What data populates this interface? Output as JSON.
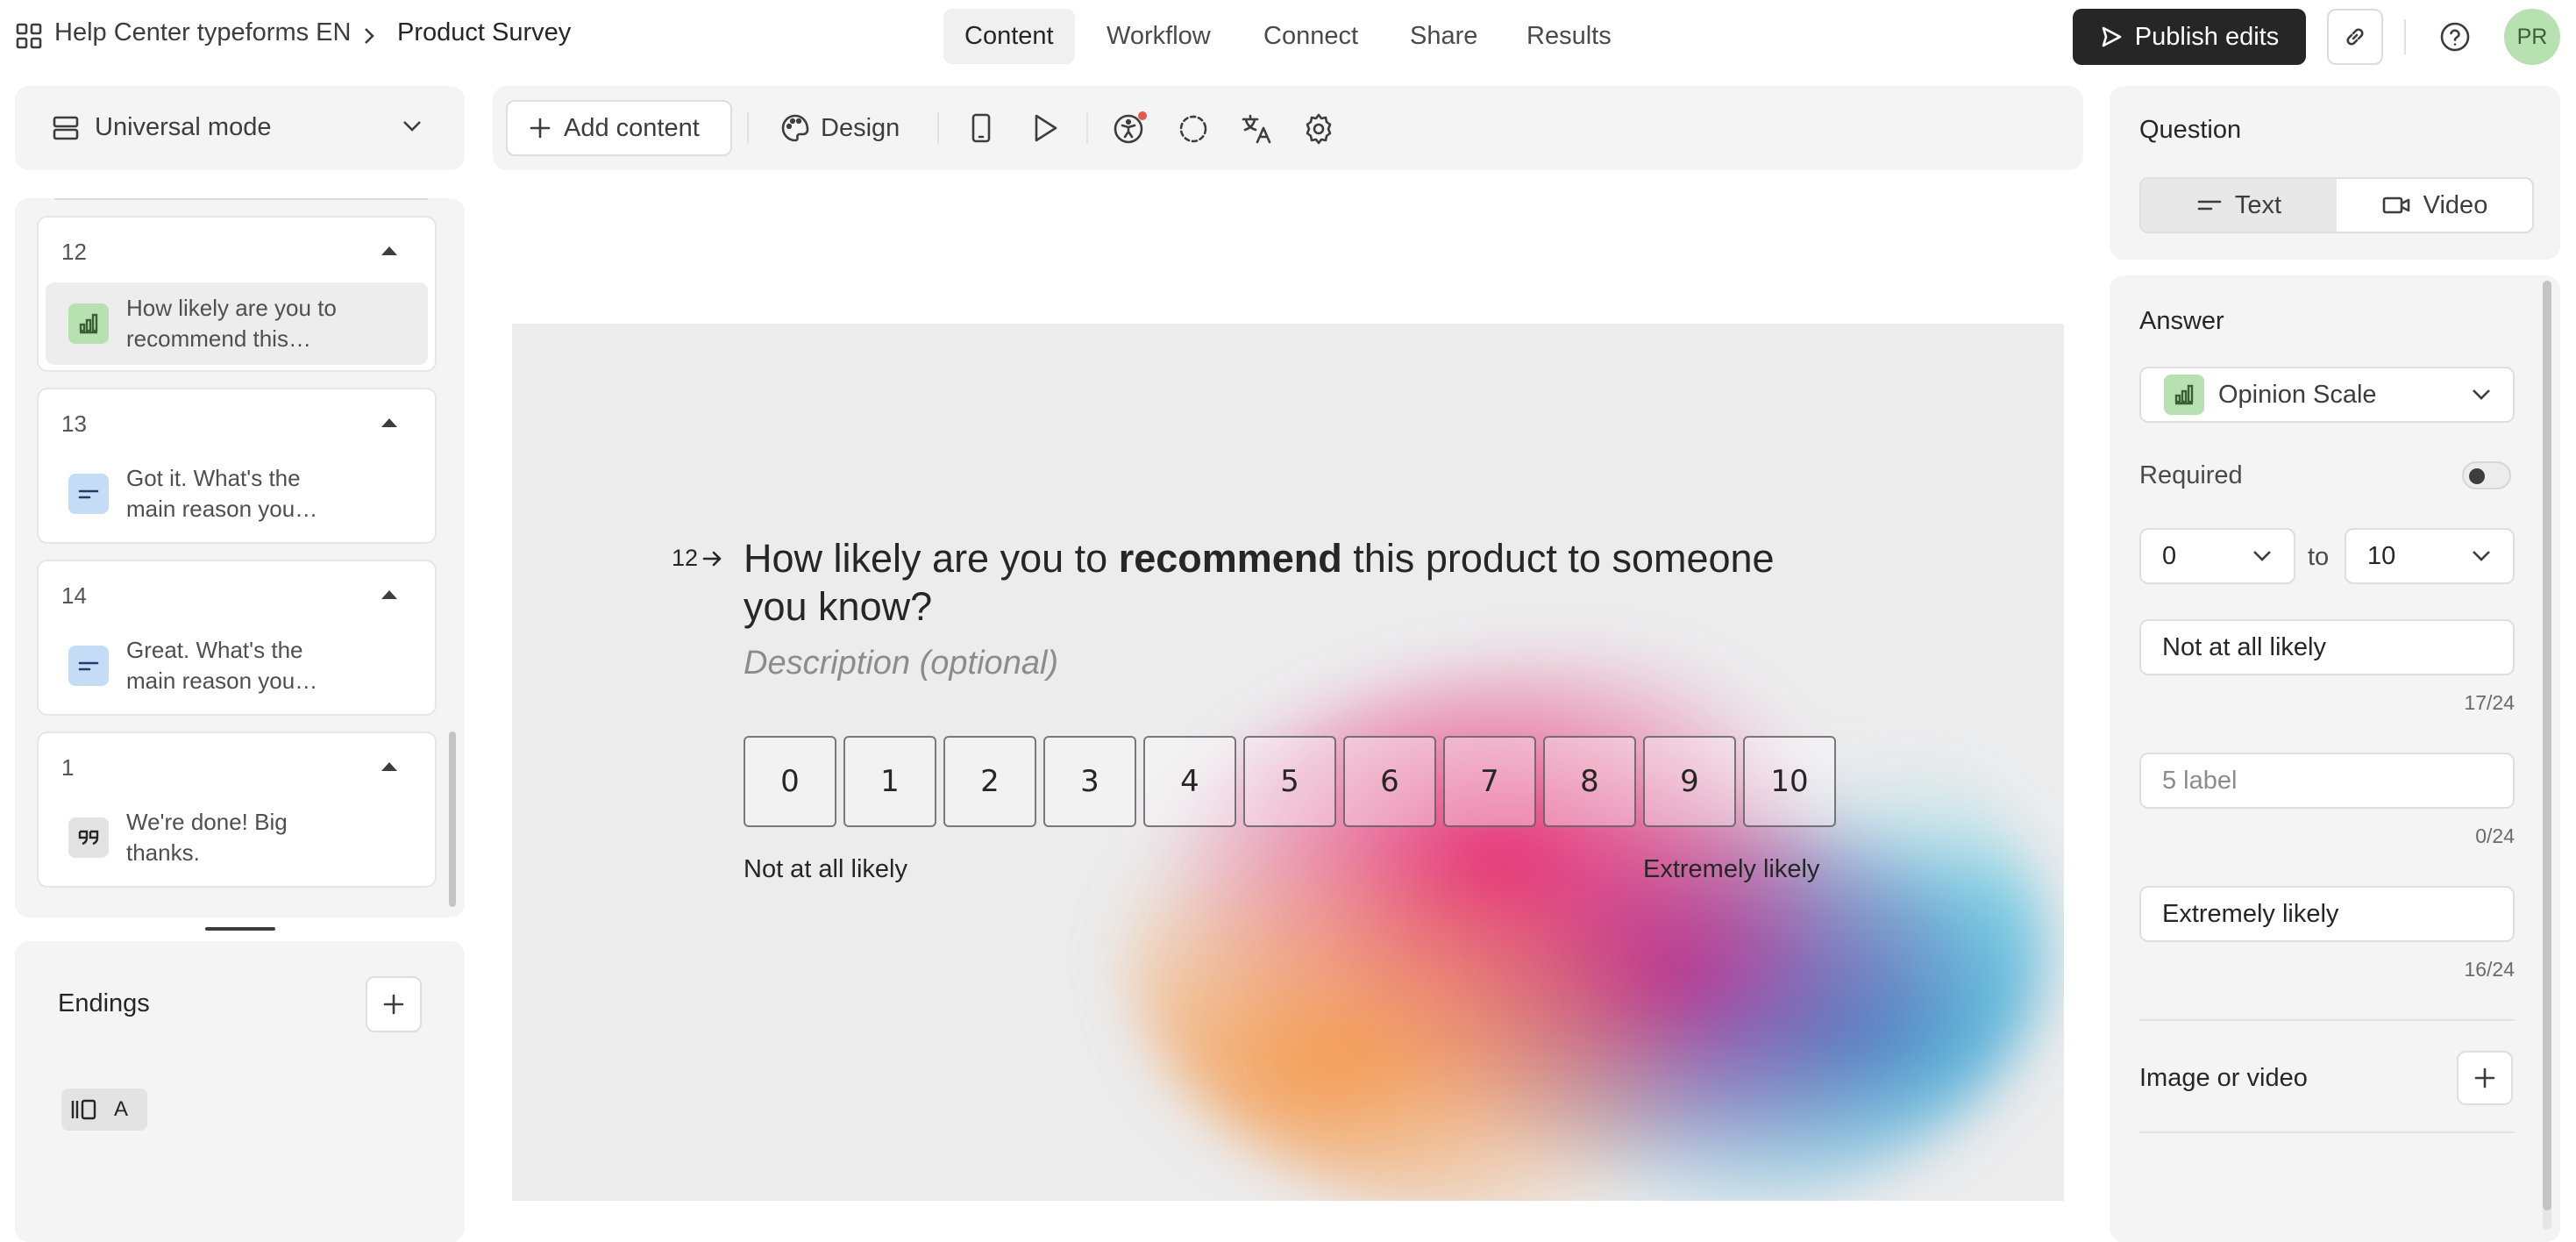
{
  "header": {
    "workspace": "Help Center typeforms EN",
    "form_title": "Product Survey",
    "tabs": [
      "Content",
      "Workflow",
      "Connect",
      "Share",
      "Results"
    ],
    "publish_label": "Publish edits",
    "avatar": "PR"
  },
  "sidebar": {
    "mode": "Universal mode",
    "questions": [
      {
        "number": "12",
        "text1": "How likely are you to",
        "text2": "recommend this…",
        "type": "opinion-scale"
      },
      {
        "number": "13",
        "text1": "Got it. What's the",
        "text2": "main reason you…",
        "type": "short-text"
      },
      {
        "number": "14",
        "text1": "Great. What's the",
        "text2": "main reason you…",
        "type": "short-text"
      },
      {
        "number": "1",
        "text1": "We're done! Big",
        "text2": "thanks.",
        "type": "ending"
      }
    ],
    "endings_title": "Endings",
    "endings_chip": "A"
  },
  "toolbar": {
    "add_content": "Add content",
    "design": "Design"
  },
  "canvas": {
    "question_number": "12",
    "question_before": "How likely are you to ",
    "question_bold": "recommend",
    "question_after_line1": " this product to someone",
    "question_line2": "you know?",
    "description_placeholder": "Description (optional)",
    "scale": [
      "0",
      "1",
      "2",
      "3",
      "4",
      "5",
      "6",
      "7",
      "8",
      "9",
      "10"
    ],
    "left_label": "Not at all likely",
    "right_label": "Extremely likely"
  },
  "settings": {
    "question_title": "Question",
    "text_tab": "Text",
    "video_tab": "Video",
    "answer_title": "Answer",
    "answer_type": "Opinion Scale",
    "required_label": "Required",
    "required_on": false,
    "from_value": "0",
    "to_word": "to",
    "to_value": "10",
    "label_left_value": "Not at all likely",
    "label_left_counter": "17/24",
    "label_mid_placeholder": "5 label",
    "label_mid_counter": "0/24",
    "label_right_value": "Extremely likely",
    "label_right_counter": "16/24",
    "image_video_label": "Image or video"
  },
  "colors": {
    "accent_dark": "#262626",
    "opinion_icon_bg": "#b7e1b1",
    "text_icon_bg": "#c5dcf6",
    "ending_icon_bg": "#e3e3e3",
    "avatar_bg": "#b7e1b1"
  }
}
